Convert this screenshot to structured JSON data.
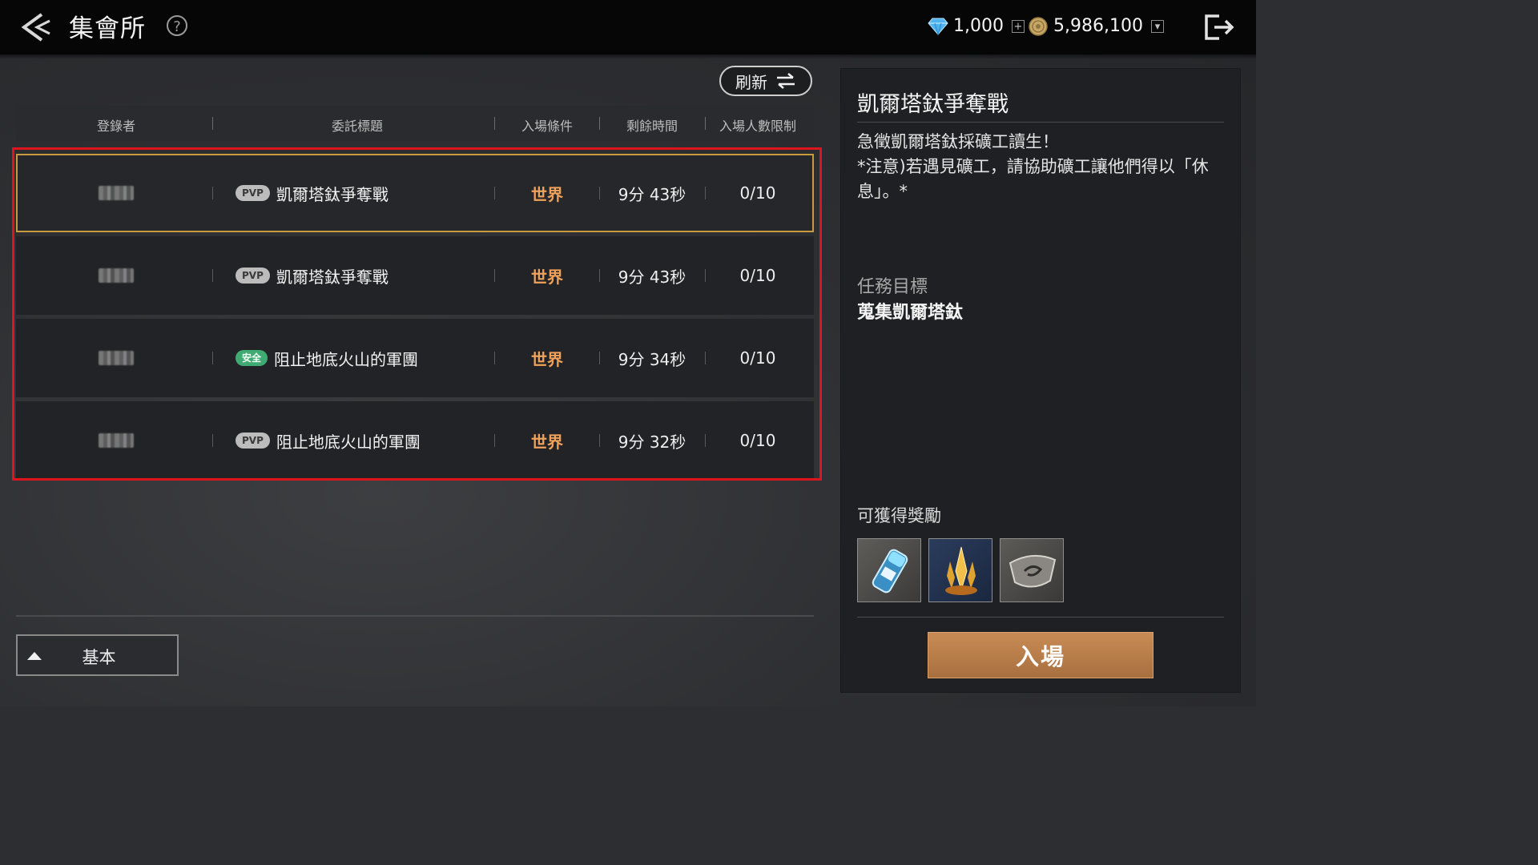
{
  "header": {
    "title": "集會所",
    "help_symbol": "?",
    "gems": "1,000",
    "gold": "5,986,100",
    "plus_symbol": "+",
    "dropdown_symbol": "▾"
  },
  "toolbar": {
    "refresh_label": "刷新"
  },
  "table": {
    "columns": [
      "登錄者",
      "委託標題",
      "入場條件",
      "剩餘時間",
      "入場人數限制"
    ],
    "rows": [
      {
        "tag": "PVP",
        "tag_type": "pvp",
        "title": "凱爾塔鈦爭奪戰",
        "condition": "世界",
        "time": "9分 43秒",
        "limit": "0/10"
      },
      {
        "tag": "PVP",
        "tag_type": "pvp",
        "title": "凱爾塔鈦爭奪戰",
        "condition": "世界",
        "time": "9分 43秒",
        "limit": "0/10"
      },
      {
        "tag": "安全",
        "tag_type": "safe",
        "title": "阻止地底火山的軍團",
        "condition": "世界",
        "time": "9分 34秒",
        "limit": "0/10"
      },
      {
        "tag": "PVP",
        "tag_type": "pvp",
        "title": "阻止地底火山的軍團",
        "condition": "世界",
        "time": "9分 32秒",
        "limit": "0/10"
      }
    ]
  },
  "filter": {
    "basic_label": "基本"
  },
  "detail": {
    "title": "凱爾塔鈦爭奪戰",
    "description": "急徵凱爾塔鈦採礦工讀生！\n*注意)若遇見礦工，請協助礦工讓他們得以「休息」。*",
    "goal_label": "任務目標",
    "goal_text": "蒐集凱爾塔鈦",
    "reward_label": "可獲得獎勵",
    "rewards": [
      "potion-icon",
      "crystal-icon",
      "emblem-icon"
    ],
    "enter_label": "入場"
  },
  "colors": {
    "accent_condition": "#f0a25a",
    "selected_border": "#c99a3e",
    "highlight_box": "#e0141d",
    "enter_button": "#c88b55",
    "safe_tag": "#3faa72"
  }
}
